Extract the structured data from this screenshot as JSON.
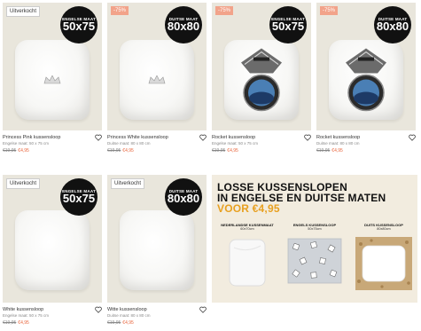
{
  "products": [
    {
      "badge": "Uitverkocht",
      "badge_type": "sold",
      "size_label": "ENGELSE MAAT",
      "size": "50x75",
      "name": "Princess Pink kussensloop",
      "sub": "Engelse maat: 50 x 75 cm",
      "old_price": "€19,95",
      "new_price": "€4,95",
      "motif": "crown"
    },
    {
      "badge": "-75%",
      "badge_type": "sale",
      "size_label": "DUITSE MAAT",
      "size": "80x80",
      "name": "Princess White kussensloop",
      "sub": "Duitse maat: 80 x 80 cm",
      "old_price": "€19,95",
      "new_price": "€4,95",
      "motif": "crown"
    },
    {
      "badge": "-75%",
      "badge_type": "sale",
      "size_label": "ENGELSE MAAT",
      "size": "50x75",
      "name": "Rocket kussensloop",
      "sub": "Engelse maat: 50 x 75 cm",
      "old_price": "€19,95",
      "new_price": "€4,95",
      "motif": "rocket"
    },
    {
      "badge": "-75%",
      "badge_type": "sale",
      "size_label": "DUITSE MAAT",
      "size": "80x80",
      "name": "Rocket kussensloop",
      "sub": "Duitse maat: 80 x 80 cm",
      "old_price": "€19,95",
      "new_price": "€4,95",
      "motif": "rocket"
    },
    {
      "badge": "Uitverkocht",
      "badge_type": "sold",
      "size_label": "ENGELSE MAAT",
      "size": "50x75",
      "name": "White kussensloop",
      "sub": "Engelse maat: 50 x 75 cm",
      "old_price": "€19,95",
      "new_price": "€4,95",
      "motif": "plain"
    },
    {
      "badge": "Uitverkocht",
      "badge_type": "sold",
      "size_label": "DUITSE MAAT",
      "size": "80x80",
      "name": "Witte kussensloop",
      "sub": "Duitse maat: 80 x 80 cm",
      "old_price": "€19,95",
      "new_price": "€4,95",
      "motif": "plain"
    }
  ],
  "promo": {
    "line1": "LOSSE KUSSENSLOPEN",
    "line2": "IN ENGELSE EN DUITSE MATEN",
    "line3": "VOOR €4,95",
    "columns": [
      {
        "title": "NEDERLANDSE KUSSENMAAT",
        "size": "60x70cm"
      },
      {
        "title": "ENGELS KUSSENSLOOP",
        "size": "50x75cm"
      },
      {
        "title": "DUITS KUSSENSLOOP",
        "size": "80x80cm"
      }
    ]
  },
  "colors": {
    "sale_badge": "#f2a38a",
    "new_price": "#e8663d",
    "promo_accent": "#e8a020",
    "image_bg": "#e9e6dc"
  },
  "icons": {
    "favorite": "heart-icon"
  }
}
